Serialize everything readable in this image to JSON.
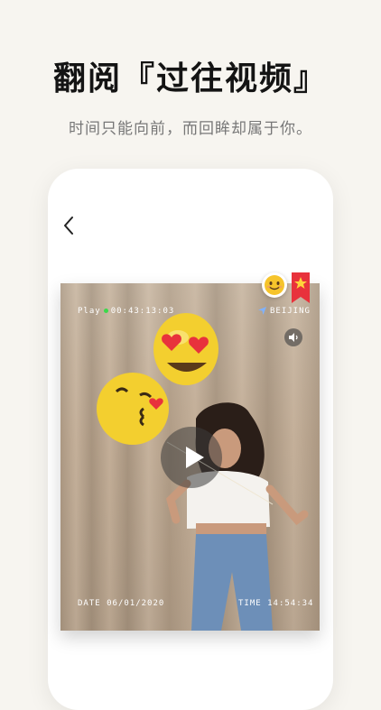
{
  "header": {
    "title": "翻阅『过往视频』",
    "subtitle": "时间只能向前，而回眸却属于你。"
  },
  "video": {
    "play_label": "Play",
    "elapsed": "00:43:13:03",
    "location": "BEIJING",
    "date_label": "DATE",
    "date_value": "06/01/2020",
    "time_label": "TIME",
    "time_value": "14:54:34"
  },
  "colors": {
    "background": "#f7f5f0",
    "bookmark": "#e8323c",
    "rec_dot": "#3bd94b",
    "balloon": "#f3cf2f"
  },
  "icons": {
    "back": "chevron-left-icon",
    "mute": "speaker-icon",
    "play": "play-icon",
    "emoji": "smiley-icon",
    "bookmark": "star-bookmark-icon",
    "location": "location-arrow-icon"
  }
}
